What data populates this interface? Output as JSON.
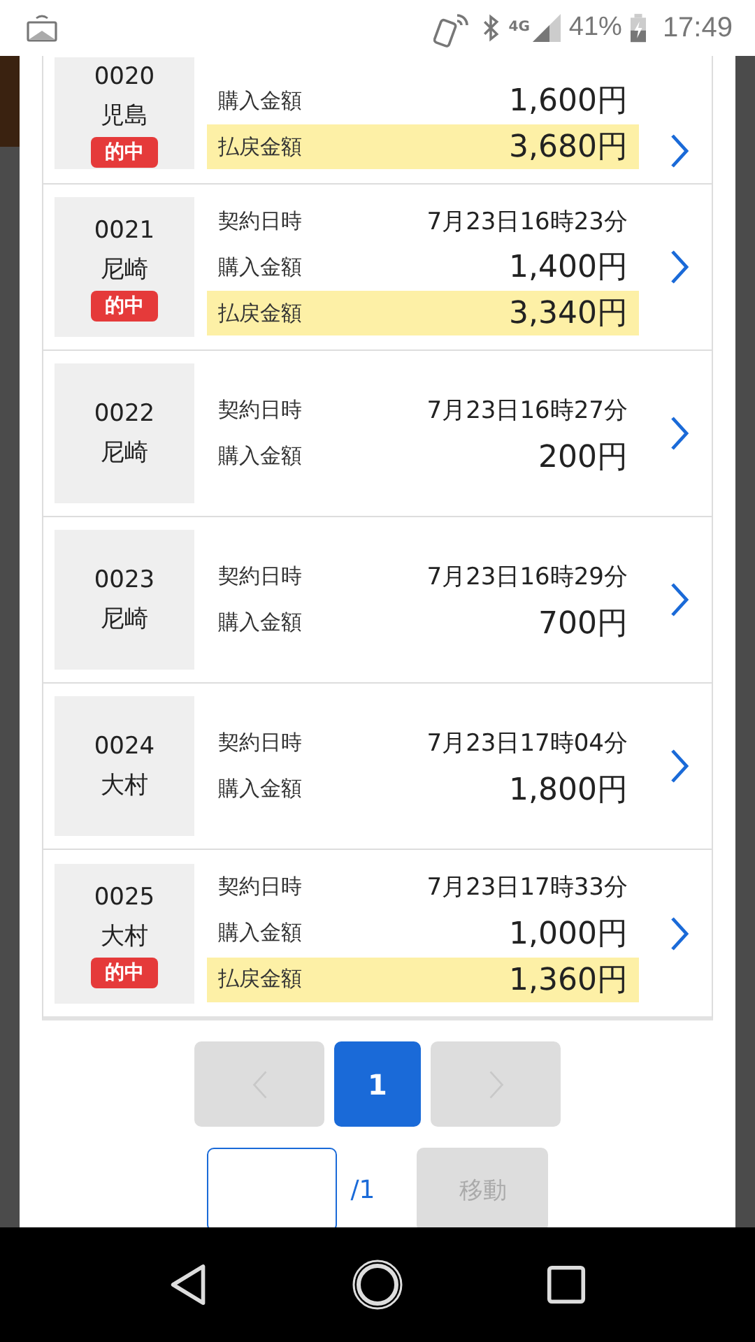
{
  "status_bar": {
    "network": "4G",
    "battery": "41%",
    "time": "17:49"
  },
  "records": [
    {
      "number": "0020",
      "place": "児島",
      "badge": "的中",
      "rows": [
        {
          "kind": "plain",
          "label": "購入金額",
          "value": "1,600円"
        },
        {
          "kind": "payout",
          "label": "払戻金額",
          "value": "3,680円"
        }
      ]
    },
    {
      "number": "0021",
      "place": "尼崎",
      "badge": "的中",
      "rows": [
        {
          "kind": "plain",
          "label": "契約日時",
          "value": "7月23日16時23分"
        },
        {
          "kind": "plain",
          "label": "購入金額",
          "value": "1,400円"
        },
        {
          "kind": "payout",
          "label": "払戻金額",
          "value": "3,340円"
        }
      ]
    },
    {
      "number": "0022",
      "place": "尼崎",
      "rows": [
        {
          "kind": "plain",
          "label": "契約日時",
          "value": "7月23日16時27分"
        },
        {
          "kind": "plain",
          "label": "購入金額",
          "value": "200円"
        }
      ]
    },
    {
      "number": "0023",
      "place": "尼崎",
      "rows": [
        {
          "kind": "plain",
          "label": "契約日時",
          "value": "7月23日16時29分"
        },
        {
          "kind": "plain",
          "label": "購入金額",
          "value": "700円"
        }
      ]
    },
    {
      "number": "0024",
      "place": "大村",
      "rows": [
        {
          "kind": "plain",
          "label": "契約日時",
          "value": "7月23日17時04分"
        },
        {
          "kind": "plain",
          "label": "購入金額",
          "value": "1,800円"
        }
      ]
    },
    {
      "number": "0025",
      "place": "大村",
      "badge": "的中",
      "rows": [
        {
          "kind": "plain",
          "label": "契約日時",
          "value": "7月23日17時33分"
        },
        {
          "kind": "plain",
          "label": "購入金額",
          "value": "1,000円"
        },
        {
          "kind": "payout",
          "label": "払戻金額",
          "value": "1,360円"
        }
      ]
    }
  ],
  "pagination": {
    "prev_disabled": true,
    "pages": [
      {
        "label": "1",
        "selected": true
      }
    ],
    "next_disabled": true
  },
  "jump": {
    "total": "/1",
    "button": "移動",
    "button_disabled": true
  }
}
